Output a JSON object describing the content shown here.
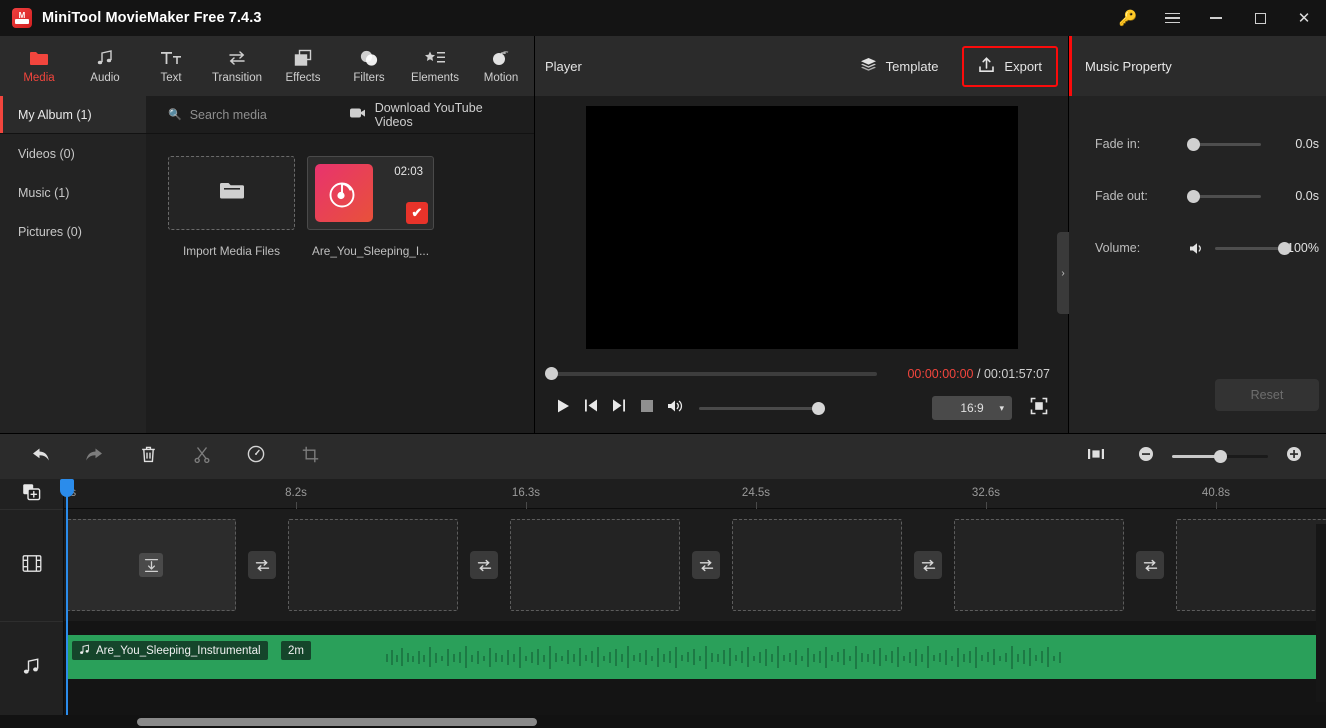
{
  "window": {
    "title": "MiniTool MovieMaker Free 7.4.3",
    "logo_text": "M",
    "controls": {
      "key": "key-icon",
      "menu": "menu-icon",
      "minimize": "—",
      "maximize": "□",
      "close": "✕"
    }
  },
  "ribbon": {
    "items": [
      {
        "label": "Media",
        "icon": "folder-icon",
        "active": true
      },
      {
        "label": "Audio",
        "icon": "music-note-icon",
        "active": false
      },
      {
        "label": "Text",
        "icon": "text-icon",
        "active": false
      },
      {
        "label": "Transition",
        "icon": "transition-icon",
        "active": false
      },
      {
        "label": "Effects",
        "icon": "effects-icon",
        "active": false
      },
      {
        "label": "Filters",
        "icon": "filters-icon",
        "active": false
      },
      {
        "label": "Elements",
        "icon": "elements-icon",
        "active": false
      },
      {
        "label": "Motion",
        "icon": "motion-icon",
        "active": false
      }
    ]
  },
  "library": {
    "active_album": "My Album (1)",
    "albums": [
      {
        "label": "Videos (0)"
      },
      {
        "label": "Music (1)"
      },
      {
        "label": "Pictures (0)"
      }
    ],
    "search_placeholder": "Search media",
    "search_value": "",
    "youtube_label": "Download YouTube Videos",
    "import_label": "Import Media Files",
    "media": [
      {
        "name": "Are_You_Sleeping_I...",
        "duration": "02:03",
        "selected": true,
        "checkmark": "✔"
      }
    ]
  },
  "player": {
    "title": "Player",
    "template_label": "Template",
    "export_label": "Export",
    "export_highlight_color": "#fb0b0b",
    "current_time": "00:00:00:00",
    "separator": "/",
    "total_time": "00:01:57:07",
    "seek_percent": 0,
    "volume_percent": 100,
    "aspect_ratio": "16:9",
    "controls": {
      "play": "play-icon",
      "prev_frame": "previous-frame-icon",
      "next_frame": "next-frame-icon",
      "stop": "stop-icon",
      "volume": "volume-icon",
      "fullscreen": "fullscreen-icon",
      "chevron": "▾"
    }
  },
  "property": {
    "title": "Music Property",
    "rows": [
      {
        "label": "Fade in:",
        "value": "0.0s",
        "knob_percent": 0
      },
      {
        "label": "Fade out:",
        "value": "0.0s",
        "knob_percent": 0
      },
      {
        "label": "Volume:",
        "value": "100%",
        "knob_percent": 100
      }
    ],
    "reset_label": "Reset",
    "collapse_icon": "›"
  },
  "timeline": {
    "tools": [
      {
        "name": "undo-button",
        "icon": "undo-icon",
        "dim": false
      },
      {
        "name": "redo-button",
        "icon": "redo-icon",
        "dim": true
      },
      {
        "name": "delete-button",
        "icon": "trash-icon",
        "dim": false
      },
      {
        "name": "split-button",
        "icon": "scissors-icon",
        "dim": true
      },
      {
        "name": "speed-button",
        "icon": "speed-icon",
        "dim": false
      },
      {
        "name": "crop-button",
        "icon": "crop-icon",
        "dim": true
      }
    ],
    "fit_icon": "fit-to-screen-icon",
    "zoom_out_icon": "zoom-out-icon",
    "zoom_in_icon": "zoom-in-icon",
    "zoom_percent": 50,
    "ruler_ticks": [
      "0s",
      "8.2s",
      "16.3s",
      "24.5s",
      "32.6s",
      "40.8s"
    ],
    "playhead_time": "0s",
    "add_track_icon": "add-track-icon",
    "video_track_icon": "film-strip-icon",
    "audio_track_icon": "music-note-icon",
    "video_slots": 6,
    "transition_icon": "transition-icon",
    "drop_icon": "drop-media-icon",
    "audio_clip": {
      "name": "Are_You_Sleeping_Instrumental",
      "badge": "2m",
      "icon": "music-note-icon",
      "color": "#2aa05a"
    }
  }
}
